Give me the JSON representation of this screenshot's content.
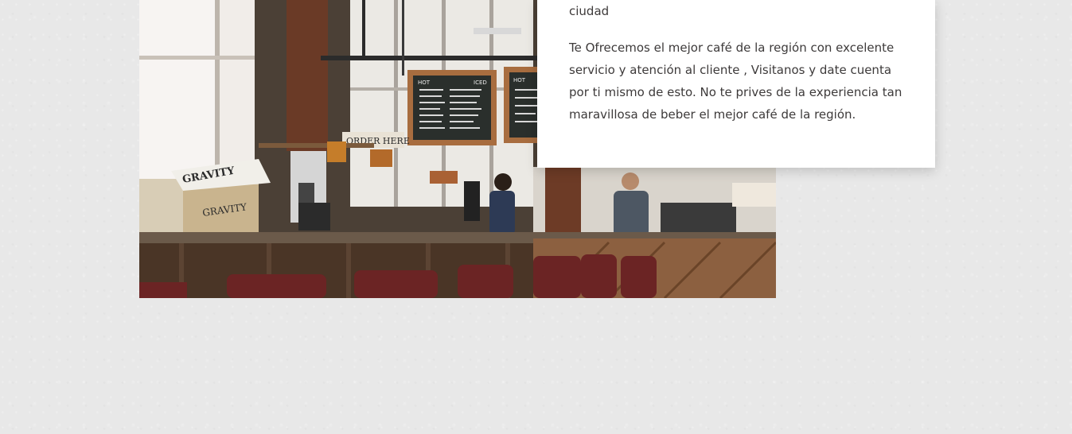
{
  "section": {
    "lead_fragment": "ciudad",
    "paragraph": "Te Ofrecemos el mejor café de la región con excelente servicio y atención al cliente , Visitanos y date cuenta por ti mismo de esto. No te prives de la experiencia tan maravillosa de beber el mejor café de la región."
  },
  "photo": {
    "signs": {
      "crate_text": "GRAVITY",
      "box_text": "GRAVITY",
      "order_sign": "ORDER HERE",
      "board_left_header_left": "HOT",
      "board_left_header_right": "ICED",
      "board_right_header": "HOT"
    }
  },
  "colors": {
    "card_bg": "#ffffff",
    "text": "#3d3a3a",
    "page_bg": "#e8e8e8"
  }
}
